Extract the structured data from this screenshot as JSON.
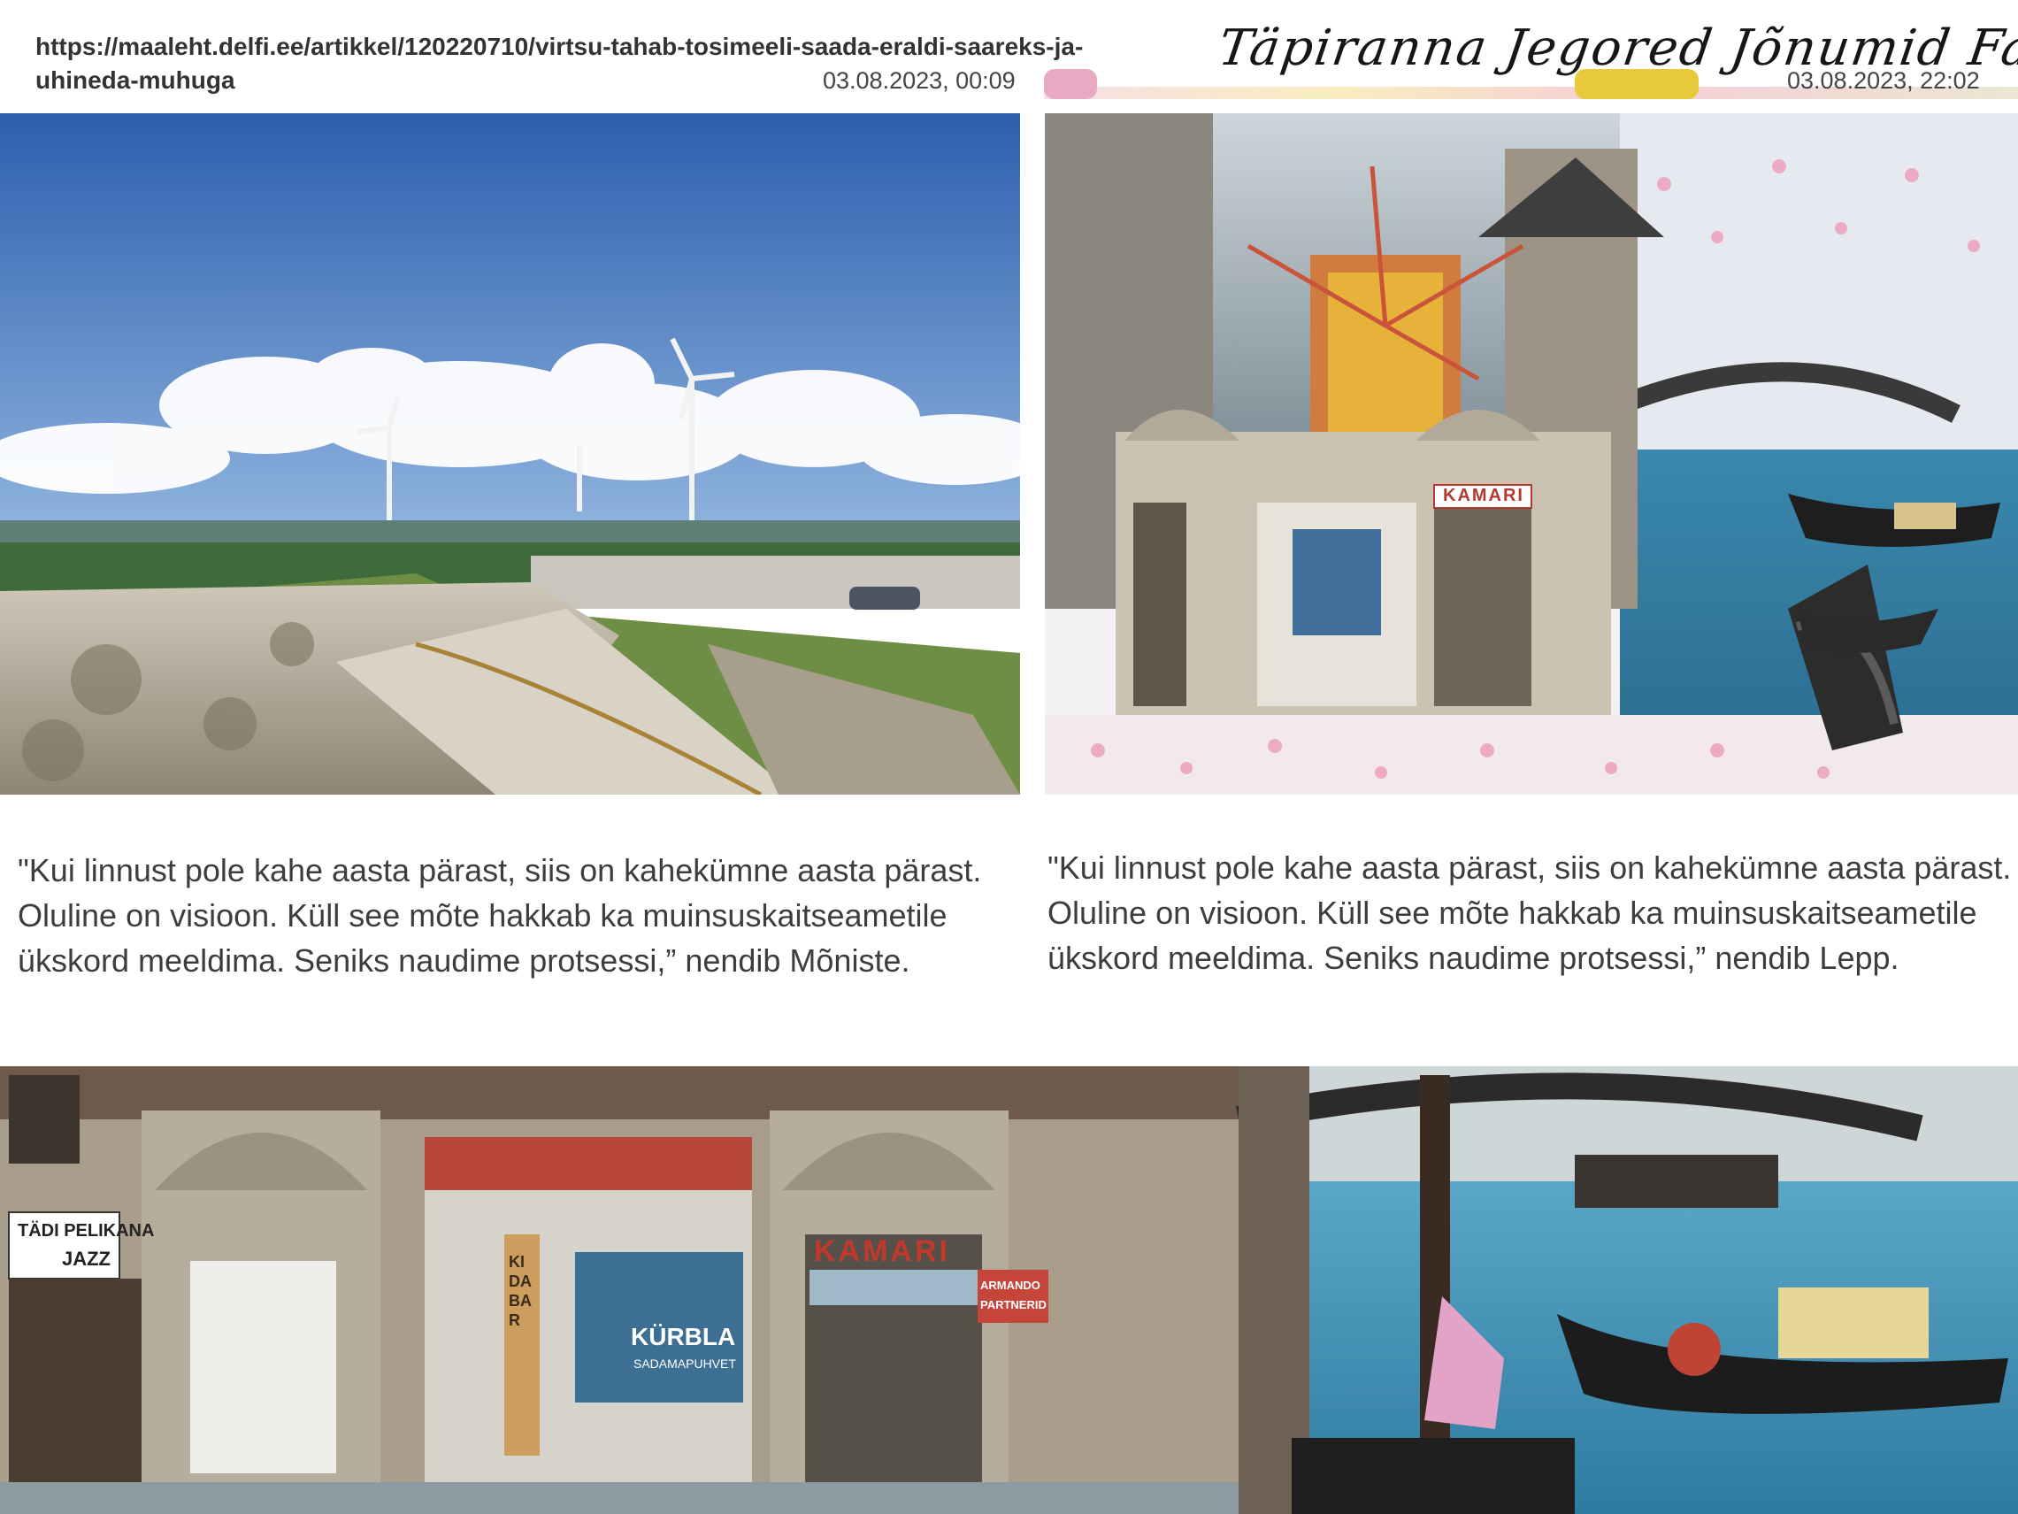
{
  "header": {
    "url_text": "https://maaleht.delfi.ee/artikkel/120220710/virtsu-tahab-tosimeeli-saada-eraldi-saareks-ja-uhineda-muhuga",
    "date_left": "03.08.2023, 00:09",
    "date_right": "03.08.2023, 22:02",
    "script_title": "Täpiranna Jegored Jõnumid Fashion House"
  },
  "quotes": {
    "left": "\"Kui linnust pole kahe aasta pärast, siis on kahekümne aasta pärast. Oluline on visioon. Küll see mõte hakkab ka muinsuskaitseametile ükskord meeldima. Seniks naudime protsessi,” nendib Mõniste.",
    "right": "\"Kui linnust pole kahe aasta pärast, siis on kahekümne aasta pärast. Oluline on visioon. Küll see mõte hakkab ka muinsuskaitseametile ükskord meeldima. Seniks naudime protsessi,” nendib  Lepp."
  },
  "signs": {
    "kamari": "KAMARI",
    "kurbla": "KÜRBLA",
    "kurbla_sub": "SADAMAPUHVET",
    "tadi_pelikana": "TÄDI PELIKANA",
    "jazz": "JAZZ",
    "armando_1": "ARMANDO",
    "armando_2": "PARTNERID",
    "kida_bar": "KIDA BAR"
  },
  "colors": {
    "sky": "#3f74c4",
    "water": "#3f8db1",
    "stone": "#cfc7b8",
    "text": "#3d3d3d"
  }
}
